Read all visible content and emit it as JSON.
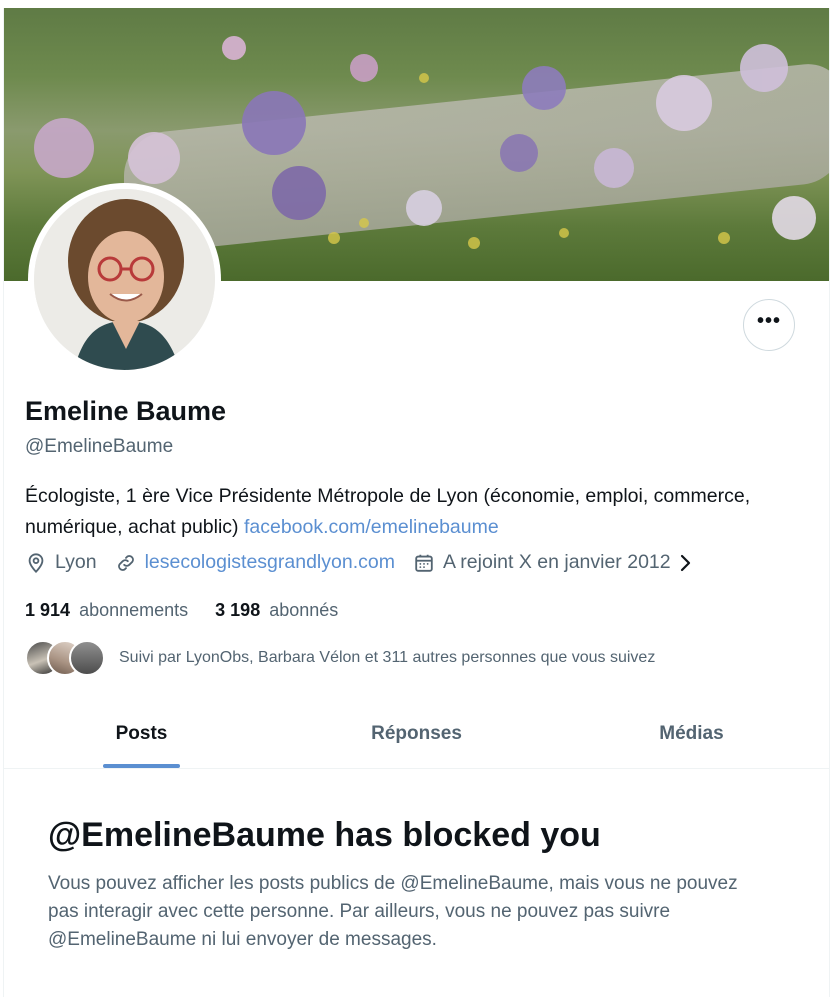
{
  "profile": {
    "name": "Emeline Baume",
    "handle": "@EmelineBaume",
    "bio_text": "Écologiste, 1 ère Vice Présidente Métropole de Lyon  (économie, emploi, commerce, numérique, achat public) ",
    "bio_link": "facebook.com/emelinebaume",
    "location": "Lyon",
    "website": "lesecologistesgrandlyon.com",
    "joined": "A rejoint X en janvier 2012",
    "following_count": "1 914",
    "following_label": "abonnements",
    "followers_count": "3 198",
    "followers_label": "abonnés",
    "followed_by": "Suivi par LyonObs, Barbara Vélon et 311 autres personnes que vous suivez"
  },
  "more_button": {
    "label": "•••"
  },
  "tabs": [
    {
      "label": "Posts",
      "active": true
    },
    {
      "label": "Réponses",
      "active": false
    },
    {
      "label": "Médias",
      "active": false
    }
  ],
  "blocked": {
    "title": "@EmelineBaume has blocked you",
    "message": "Vous pouvez afficher les posts publics de @EmelineBaume, mais vous ne pouvez pas interagir avec cette personne. Par ailleurs, vous ne pouvez pas suivre @EmelineBaume ni lui envoyer de messages."
  },
  "icons": {
    "location": "location-pin-icon",
    "link": "link-icon",
    "calendar": "calendar-icon",
    "chevron": "chevron-right-icon"
  },
  "colors": {
    "link": "#5b8fd1",
    "text_primary": "#0f1419",
    "text_secondary": "#536471",
    "border": "#cfd9de"
  }
}
